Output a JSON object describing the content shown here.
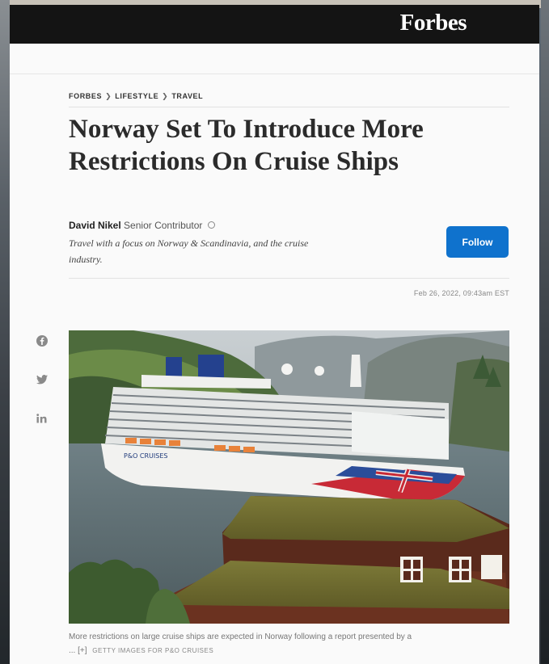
{
  "header": {
    "brand": "Forbes"
  },
  "breadcrumb": {
    "items": [
      "FORBES",
      "LIFESTYLE",
      "TRAVEL"
    ],
    "sep": "❯"
  },
  "article": {
    "title": "Norway Set To Introduce More Restrictions On Cruise Ships",
    "author": {
      "name": "David Nikel",
      "role": "Senior Contributor",
      "bio": "Travel with a focus on Norway & Scandinavia, and the cruise industry."
    },
    "follow_label": "Follow",
    "timestamp": "Feb 26, 2022, 09:43am EST",
    "caption": "More restrictions on large cruise ships are expected in Norway following a report presented by a",
    "caption_more": "... [+]",
    "credit": "GETTY IMAGES FOR P&O CRUISES",
    "ship_name": "P&O CRUISES"
  },
  "share": {
    "icons": [
      "facebook-icon",
      "twitter-icon",
      "linkedin-icon"
    ]
  },
  "colors": {
    "accent": "#0f72cd",
    "topbar": "#141414"
  }
}
